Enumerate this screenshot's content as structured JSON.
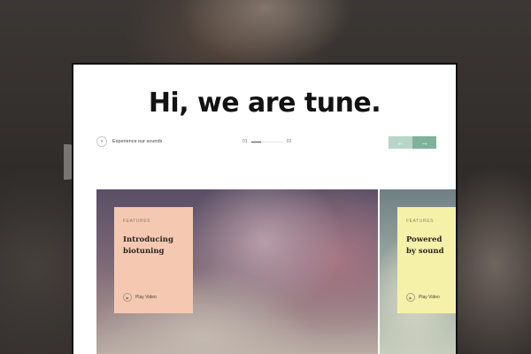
{
  "hero": {
    "title": "Hi, we are tune."
  },
  "explore": {
    "label": "Experience our sounds",
    "icon": "arrow-down-icon"
  },
  "pager": {
    "current": "01",
    "total": "03",
    "progress": 0.33
  },
  "nav": {
    "prev_icon": "arrow-left-icon",
    "next_icon": "arrow-right-icon",
    "prev_glyph": "←",
    "next_glyph": "→"
  },
  "slides": [
    {
      "tag": "FEATURES",
      "title": "Introducing\nbiotuning",
      "play_label": "Play Video",
      "card_color": "#f5c9b1"
    },
    {
      "tag": "FEATURES",
      "title": "Powered\nby sound",
      "play_label": "Play Video",
      "card_color": "#f6f1a9"
    }
  ],
  "colors": {
    "accent_light": "#b7d6c9",
    "accent": "#7fb19b",
    "title": "#121212"
  }
}
